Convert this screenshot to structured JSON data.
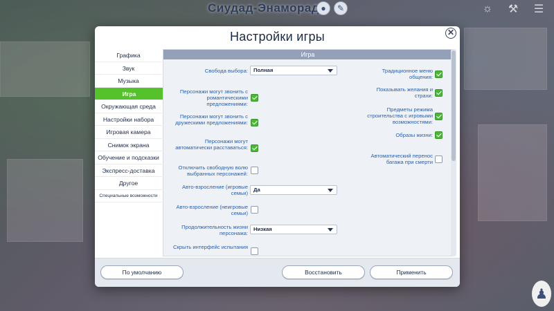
{
  "hud": {
    "world_title": "Сиудад-Энаморада",
    "location_icon": "location-pin-icon",
    "paint_icon": "paint-brush-icon",
    "top_right_icons": [
      "lightbulb-icon",
      "tool-icon",
      "menu-icon"
    ]
  },
  "dialog": {
    "title": "Настройки игры",
    "close_icon": "close-icon"
  },
  "sidebar": {
    "items": [
      {
        "label": "Графика",
        "active": false
      },
      {
        "label": "Звук",
        "active": false
      },
      {
        "label": "Музыка",
        "active": false
      },
      {
        "label": "Игра",
        "active": true
      },
      {
        "label": "Окружающая среда",
        "active": false
      },
      {
        "label": "Настройки набора",
        "active": false
      },
      {
        "label": "Игровая камера",
        "active": false
      },
      {
        "label": "Снимок экрана",
        "active": false
      },
      {
        "label": "Обучение и подсказки",
        "active": false
      },
      {
        "label": "Экспресс-доставка",
        "active": false
      },
      {
        "label": "Другое",
        "active": false
      },
      {
        "label": "Специальные возможности",
        "active": false
      }
    ]
  },
  "section": {
    "header": "Игра"
  },
  "settings_left": {
    "free_will": {
      "label": "Свобода выбора:",
      "value": "Полная"
    },
    "romantic_calls": {
      "label": "Персонажи могут звонить с романтическими предложениями:",
      "checked": true
    },
    "friendly_calls": {
      "label": "Персонажи могут звонить с дружескими предложениями:",
      "checked": true
    },
    "auto_breakup": {
      "label": "Персонажи могут автоматически расставаться:",
      "checked": true
    },
    "disable_free_will": {
      "label": "Отключить свободную волю выбранных персонажей:",
      "checked": false
    },
    "auto_aging_played": {
      "label": "Авто-взросление (игровые семьи)",
      "value": "Да"
    },
    "auto_aging_unplayed": {
      "label": "Авто-взросление (неигровые семьи)",
      "checked": false
    },
    "lifespan": {
      "label": "Продолжительность жизни персонажа:",
      "value": "Низкая"
    },
    "hide_test_ui": {
      "label": "Скрыть интерфейс испытания",
      "checked": false
    }
  },
  "settings_right": {
    "classic_menu": {
      "label": "Традиционное меню общения:",
      "checked": true
    },
    "wants_fears": {
      "label": "Показывать желания и страхи:",
      "checked": true
    },
    "build_items": {
      "label": "Предметы режима строительства с игровыми возможностями:",
      "checked": true
    },
    "life_images": {
      "label": "Образы жизни:",
      "checked": true
    },
    "auto_luggage": {
      "label": "Автоматический перенос багажа при смерти",
      "checked": false
    }
  },
  "footer": {
    "defaults_button": "По умолчанию",
    "restore_button": "Восстановить",
    "apply_button": "Применить"
  },
  "colors": {
    "accent_green": "#56c22b",
    "label_blue": "#2c5fa8",
    "header_gray": "#93a0b7"
  }
}
